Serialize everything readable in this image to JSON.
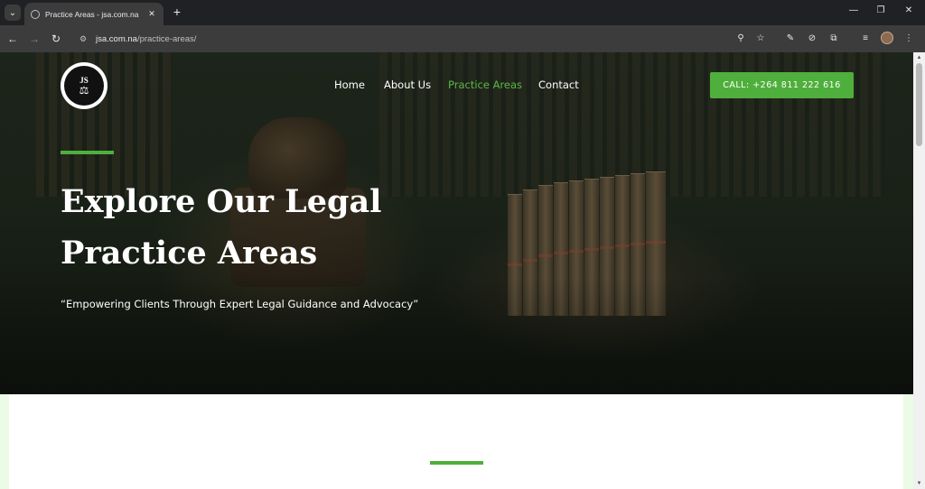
{
  "browser": {
    "tab_title": "Practice Areas - jsa.com.na",
    "tab_close": "✕",
    "tab_search": "⌄",
    "new_tab": "+",
    "url_host": "jsa.com.na",
    "url_path": "/practice-areas/",
    "controls": {
      "minimize": "—",
      "restore": "❐",
      "close": "✕"
    },
    "icons": [
      "back-icon",
      "forward-icon",
      "reload-icon",
      "site-info-icon",
      "zoom-icon",
      "bookmark-star-icon",
      "eyedropper-icon",
      "blocked-icon",
      "extensions-icon",
      "media-icon",
      "profile-avatar-icon",
      "menu-icon"
    ]
  },
  "header": {
    "logo_text": "JS",
    "logo_symbol": "⚖",
    "nav": [
      {
        "label": "Home"
      },
      {
        "label": "About Us"
      },
      {
        "label": "Practice Areas",
        "active": true
      },
      {
        "label": "Contact"
      }
    ],
    "cta_label": "CALL: +264 811 222 616"
  },
  "hero": {
    "title_line1": "Explore Our Legal",
    "title_line2": "Practice Areas",
    "subtitle": "“Empowering Clients Through Expert Legal Guidance and Advocacy”"
  },
  "colors": {
    "accent": "#4faf3c",
    "active_nav": "#58b847",
    "hero_bg": "#1a2218",
    "page_bg": "#ecfbe5"
  }
}
